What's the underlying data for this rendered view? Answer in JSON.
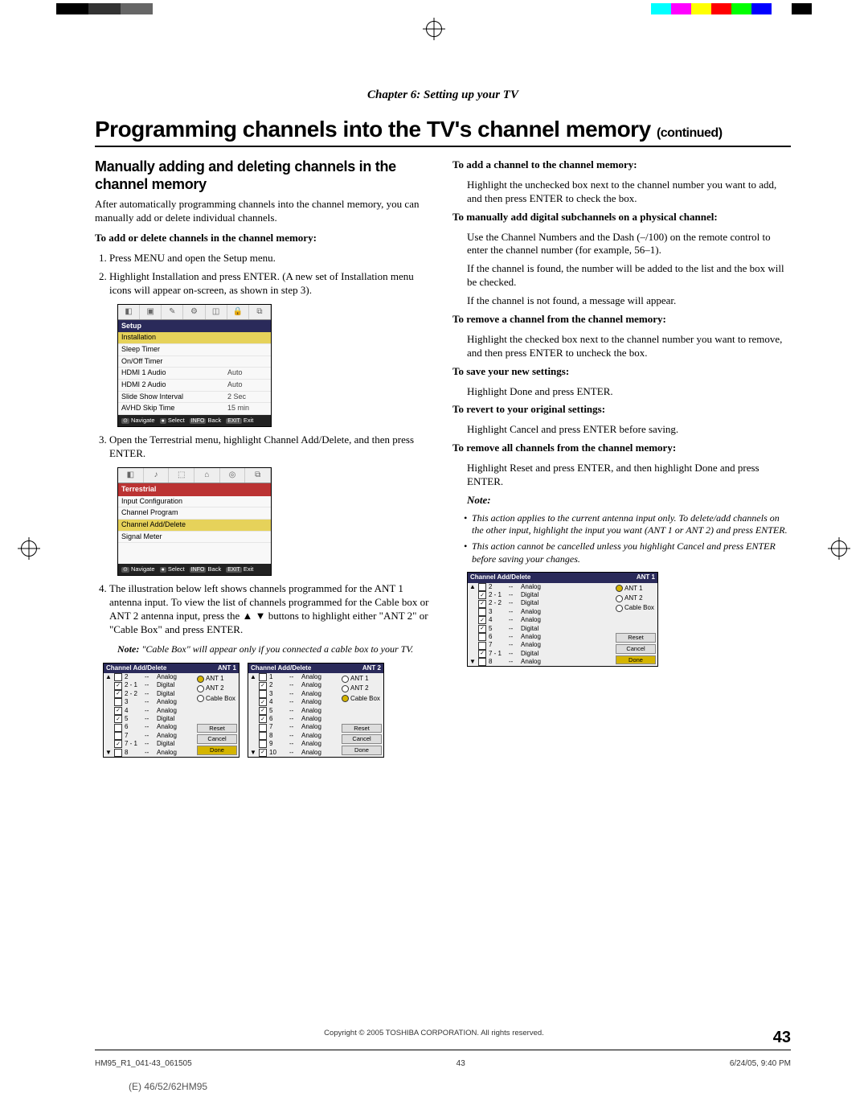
{
  "chapter": "Chapter 6: Setting up your TV",
  "title_main": "Programming channels into the TV's channel memory ",
  "title_cont": "(continued)",
  "left": {
    "h2": "Manually adding and deleting channels in the channel memory",
    "intro": "After automatically programming channels into the channel memory, you can manually add or delete individual channels.",
    "addDelHead": "To add or delete channels in the channel memory:",
    "steps": [
      "Press MENU and open the Setup menu.",
      "Highlight Installation and press ENTER. (A new set of Installation menu icons will appear on-screen, as shown in step 3).",
      "Open the Terrestrial menu, highlight Channel Add/Delete, and then press ENTER.",
      "The illustration below left shows channels programmed for the ANT 1 antenna input. To view the list of channels programmed for the Cable box or ANT 2 antenna input, press the ▲ ▼ buttons to highlight either \"ANT 2\" or \"Cable Box\" and press ENTER."
    ],
    "noteInline": "\"Cable Box\" will appear only if you connected a cable box to your TV."
  },
  "osd_setup": {
    "title": "Setup",
    "rows": [
      {
        "l": "Installation",
        "sel": true
      },
      {
        "l": "Sleep Timer"
      },
      {
        "l": "On/Off Timer"
      },
      {
        "l": "HDMI 1 Audio",
        "r": "Auto"
      },
      {
        "l": "HDMI 2 Audio",
        "r": "Auto"
      },
      {
        "l": "Slide Show Interval",
        "r": "2 Sec"
      },
      {
        "l": "AVHD Skip Time",
        "r": "15 min"
      }
    ],
    "footer": [
      "Navigate",
      "Select",
      "Back",
      "Exit"
    ]
  },
  "osd_terr": {
    "title": "Terrestrial",
    "rows": [
      {
        "l": "Input Configuration"
      },
      {
        "l": "Channel Program"
      },
      {
        "l": "Channel Add/Delete",
        "sel": true
      },
      {
        "l": "Signal Meter"
      }
    ],
    "footer": [
      "Navigate",
      "Select",
      "Back",
      "Exit"
    ]
  },
  "chlist1": {
    "title": "Channel Add/Delete",
    "ant": "ANT 1",
    "rows": [
      {
        "c": false,
        "ch": "2",
        "ty": "Analog"
      },
      {
        "c": true,
        "ch": "2 - 1",
        "ty": "Digital"
      },
      {
        "c": true,
        "ch": "2 - 2",
        "ty": "Digital"
      },
      {
        "c": false,
        "ch": "3",
        "ty": "Analog"
      },
      {
        "c": true,
        "ch": "4",
        "ty": "Analog"
      },
      {
        "c": true,
        "ch": "5",
        "ty": "Digital"
      },
      {
        "c": false,
        "ch": "6",
        "ty": "Analog"
      },
      {
        "c": false,
        "ch": "7",
        "ty": "Analog"
      },
      {
        "c": true,
        "ch": "7 - 1",
        "ty": "Digital"
      },
      {
        "c": false,
        "ch": "8",
        "ty": "Analog"
      }
    ],
    "opts": [
      {
        "l": "ANT 1",
        "on": true
      },
      {
        "l": "ANT 2"
      },
      {
        "l": "Cable Box"
      }
    ],
    "btns": [
      "Reset",
      "Cancel",
      "Done"
    ],
    "selBtn": "Done"
  },
  "chlist2": {
    "title": "Channel Add/Delete",
    "ant": "ANT 2",
    "rows": [
      {
        "c": false,
        "ch": "1",
        "ty": "Analog"
      },
      {
        "c": true,
        "ch": "2",
        "ty": "Analog"
      },
      {
        "c": false,
        "ch": "3",
        "ty": "Analog"
      },
      {
        "c": true,
        "ch": "4",
        "ty": "Analog"
      },
      {
        "c": true,
        "ch": "5",
        "ty": "Analog"
      },
      {
        "c": true,
        "ch": "6",
        "ty": "Analog"
      },
      {
        "c": false,
        "ch": "7",
        "ty": "Analog"
      },
      {
        "c": false,
        "ch": "8",
        "ty": "Analog"
      },
      {
        "c": false,
        "ch": "9",
        "ty": "Analog"
      },
      {
        "c": true,
        "ch": "10",
        "ty": "Analog"
      }
    ],
    "opts": [
      {
        "l": "ANT 1"
      },
      {
        "l": "ANT 2"
      },
      {
        "l": "Cable Box",
        "on": true
      }
    ],
    "btns": [
      "Reset",
      "Cancel",
      "Done"
    ]
  },
  "right": {
    "addHead": "To add a channel to the channel memory:",
    "addBody": "Highlight the unchecked box next to the channel number you want to add, and then press ENTER to check the box.",
    "subHead": "To manually add digital subchannels on a physical channel:",
    "subBody1": "Use the Channel Numbers and the Dash (–/100) on the remote control to enter the channel number (for example, 56–1).",
    "subBody2": "If the channel is found, the number will be added to the list and the box will be checked.",
    "subBody3": "If the channel is not found, a message will appear.",
    "remHead": "To remove a channel from the channel memory:",
    "remBody": "Highlight the checked box next to the channel number you want to remove, and then press ENTER to uncheck the box.",
    "saveHead": "To save your new settings:",
    "saveBody": "Highlight Done and press ENTER.",
    "revHead": "To revert to your original settings:",
    "revBody": "Highlight Cancel and press ENTER before saving.",
    "remAllHead": "To remove all channels from the channel memory:",
    "remAllBody": "Highlight Reset and press ENTER, and then highlight Done and press ENTER.",
    "noteLabel": "Note:",
    "notes": [
      "This action applies to the current antenna input only. To delete/add channels on the other input, highlight the input you want (ANT 1 or ANT 2) and press ENTER.",
      "This action cannot be cancelled unless you highlight Cancel and press ENTER before saving your changes."
    ]
  },
  "copyright": "Copyright © 2005 TOSHIBA CORPORATION. All rights reserved.",
  "pagenum": "43",
  "footL": "HM95_R1_041-43_061505",
  "footM": "43",
  "footR": "6/24/05, 9:40 PM",
  "model": "(E) 46/52/62HM95",
  "colorbars": [
    "#000",
    "#333",
    "#666",
    "#fff",
    "#0ff",
    "#f0f",
    "#ff0",
    "#f00",
    "#0f0",
    "#00f",
    "#fff",
    "#000"
  ]
}
